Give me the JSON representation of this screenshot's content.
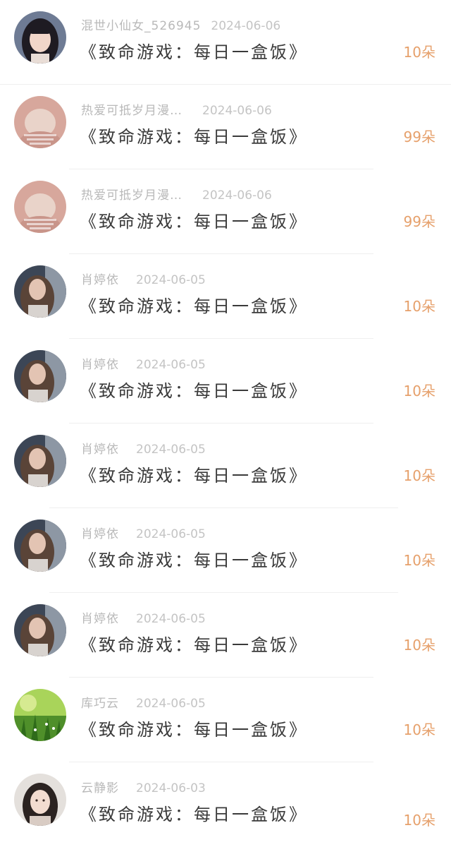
{
  "gift_records": [
    {
      "name": "混世小仙女_526945",
      "date": "2024-06-06",
      "title": "《致命游戏：每日一盒饭》",
      "amount": "10朵",
      "avatar": "girl-portrait-avatar"
    },
    {
      "name": "热爱可抵岁月漫…",
      "date": "2024-06-06",
      "title": "《致命游戏：每日一盒饭》",
      "amount": "99朵",
      "avatar": "pink-blurred-animal-avatar"
    },
    {
      "name": "热爱可抵岁月漫…",
      "date": "2024-06-06",
      "title": "《致命游戏：每日一盒饭》",
      "amount": "99朵",
      "avatar": "pink-blurred-animal-avatar"
    },
    {
      "name": "肖婷依",
      "date": "2024-06-05",
      "title": "《致命游戏：每日一盒饭》",
      "amount": "10朵",
      "avatar": "curly-hair-girl-avatar"
    },
    {
      "name": "肖婷依",
      "date": "2024-06-05",
      "title": "《致命游戏：每日一盒饭》",
      "amount": "10朵",
      "avatar": "curly-hair-girl-avatar"
    },
    {
      "name": "肖婷依",
      "date": "2024-06-05",
      "title": "《致命游戏：每日一盒饭》",
      "amount": "10朵",
      "avatar": "curly-hair-girl-avatar"
    },
    {
      "name": "肖婷依",
      "date": "2024-06-05",
      "title": "《致命游戏：每日一盒饭》",
      "amount": "10朵",
      "avatar": "curly-hair-girl-avatar"
    },
    {
      "name": "肖婷依",
      "date": "2024-06-05",
      "title": "《致命游戏：每日一盒饭》",
      "amount": "10朵",
      "avatar": "curly-hair-girl-avatar"
    },
    {
      "name": "库巧云",
      "date": "2024-06-05",
      "title": "《致命游戏：每日一盒饭》",
      "amount": "10朵",
      "avatar": "green-grass-avatar"
    },
    {
      "name": "云静影",
      "date": "2024-06-03",
      "title": "《致命游戏：每日一盒饭》",
      "amount": "10朵",
      "avatar": "illustrated-girl-avatar"
    }
  ],
  "colors": {
    "amount": "#e6a06b",
    "meta": "#b9b9b9",
    "title": "#3a3a3a"
  }
}
